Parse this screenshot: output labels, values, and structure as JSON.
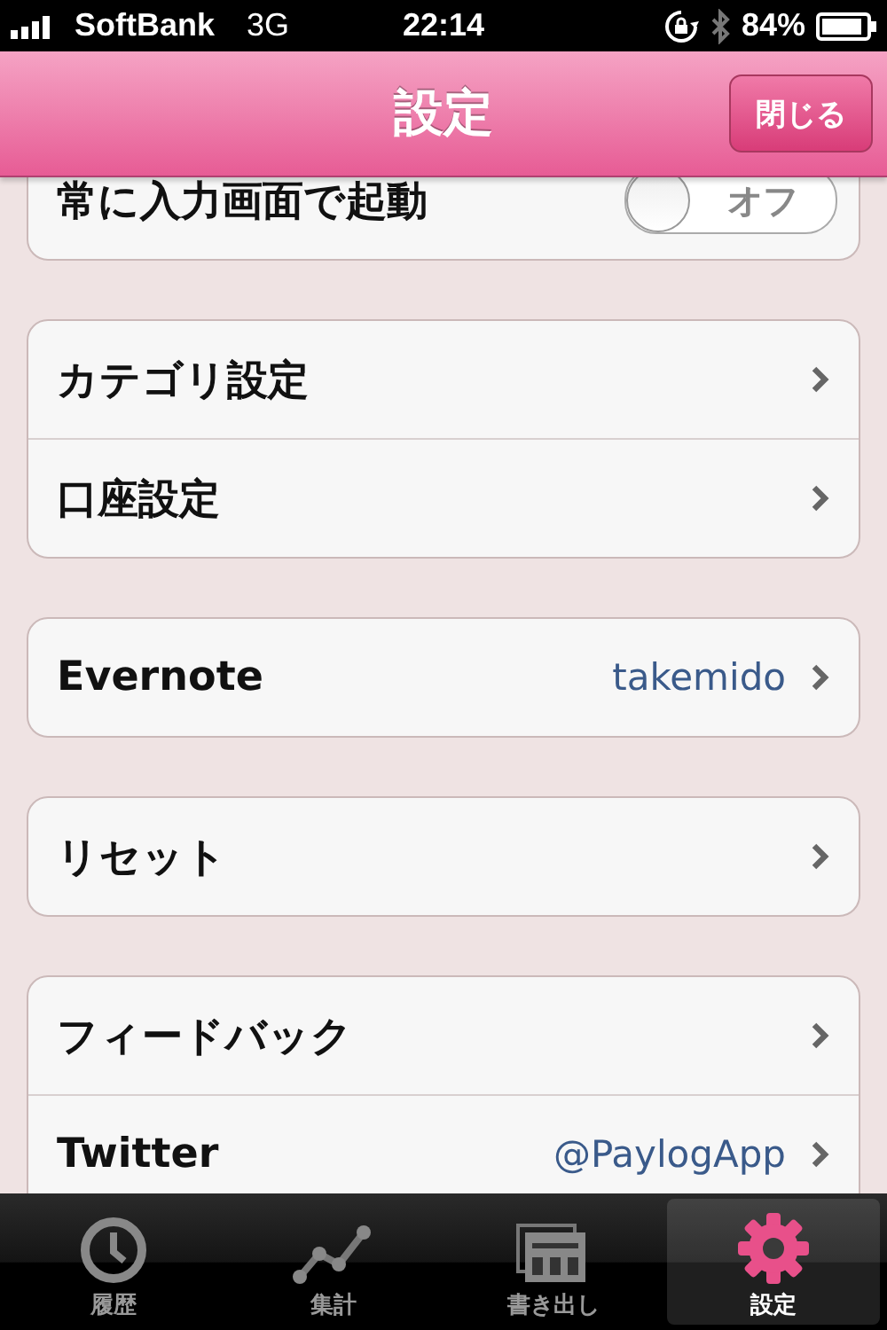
{
  "status_bar": {
    "carrier": "SoftBank",
    "network": "3G",
    "time": "22:14",
    "battery": "84%"
  },
  "nav": {
    "title": "設定",
    "close_button": "閉じる"
  },
  "groups": [
    {
      "rows": [
        {
          "kind": "toggle",
          "label": "常に入力画面で起動",
          "on": false,
          "toggle_text": "オフ"
        }
      ]
    },
    {
      "rows": [
        {
          "kind": "link",
          "label": "カテゴリ設定"
        },
        {
          "kind": "link",
          "label": "口座設定"
        }
      ]
    },
    {
      "rows": [
        {
          "kind": "link",
          "label": "Evernote",
          "value": "takemido"
        }
      ]
    },
    {
      "rows": [
        {
          "kind": "link",
          "label": "リセット"
        }
      ]
    },
    {
      "rows": [
        {
          "kind": "link",
          "label": "フィードバック"
        },
        {
          "kind": "link",
          "label": "Twitter",
          "value": "@PaylogApp"
        }
      ]
    }
  ],
  "tabs": [
    {
      "kind": "history",
      "label": "履歴",
      "selected": false
    },
    {
      "kind": "stats",
      "label": "集計",
      "selected": false
    },
    {
      "kind": "export",
      "label": "書き出し",
      "selected": false
    },
    {
      "kind": "settings",
      "label": "設定",
      "selected": true
    }
  ]
}
